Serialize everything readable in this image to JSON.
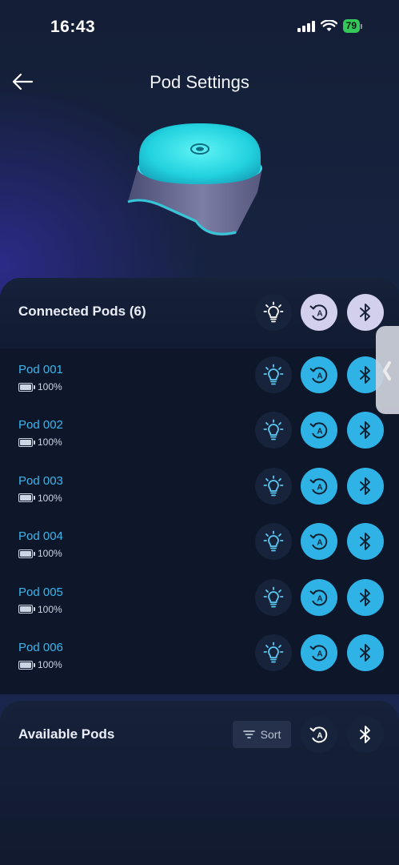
{
  "status_bar": {
    "time": "16:43",
    "battery": "79",
    "icons": [
      "signal-icon",
      "wifi-icon",
      "battery-icon"
    ]
  },
  "header": {
    "title": "Pod Settings",
    "back_icon": "back-arrow-icon"
  },
  "connected": {
    "title": "Connected Pods (6)",
    "actions": [
      "lightbulb-icon",
      "auto-sync-icon",
      "bluetooth-icon"
    ],
    "pods": [
      {
        "name": "Pod 001",
        "battery": "100%",
        "level": 1.0
      },
      {
        "name": "Pod 002",
        "battery": "100%",
        "level": 1.0
      },
      {
        "name": "Pod 003",
        "battery": "100%",
        "level": 1.0
      },
      {
        "name": "Pod 004",
        "battery": "100%",
        "level": 1.0
      },
      {
        "name": "Pod 005",
        "battery": "100%",
        "level": 1.0
      },
      {
        "name": "Pod 006",
        "battery": "100%",
        "level": 1.0
      }
    ]
  },
  "available": {
    "title": "Available Pods",
    "sort_label": "Sort",
    "actions": [
      "sort-icon",
      "auto-sync-icon",
      "bluetooth-icon"
    ]
  },
  "colors": {
    "accent": "#2fb3e6",
    "pod_name": "#3ab6ee",
    "panel": "#0e1729",
    "highlight_button": "#d2d0ec"
  }
}
